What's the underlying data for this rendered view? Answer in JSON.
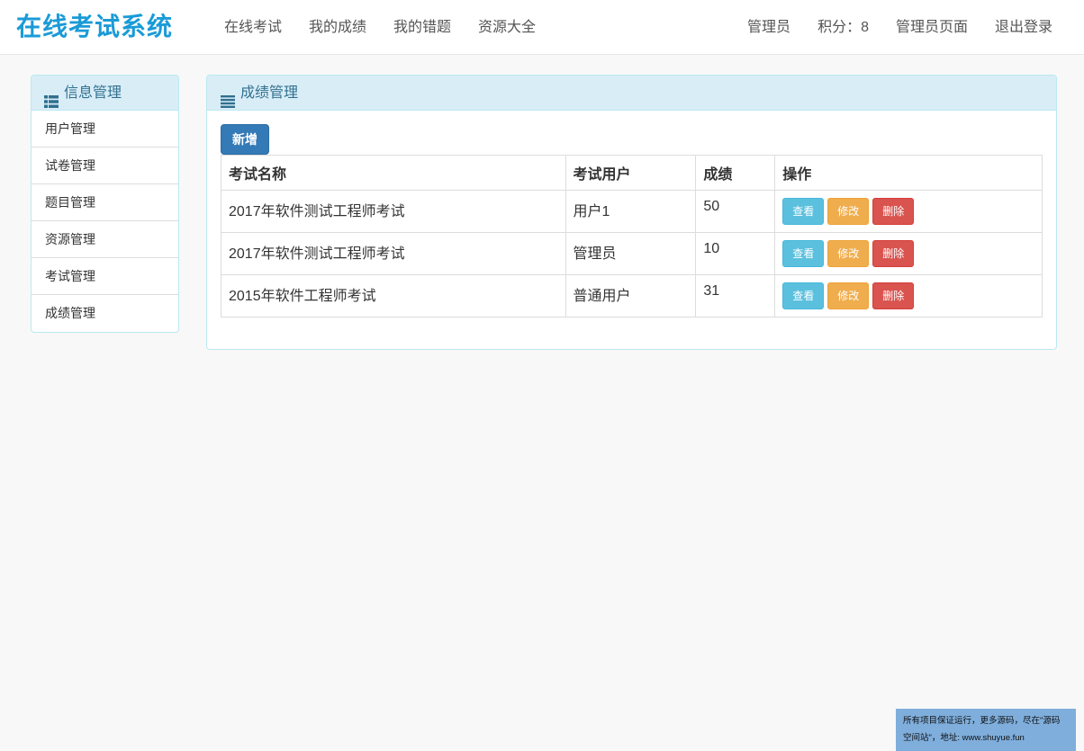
{
  "navbar": {
    "brand": "在线考试系统",
    "left_links": [
      "在线考试",
      "我的成绩",
      "我的错题",
      "资源大全"
    ],
    "user_name": "管理员",
    "points": "积分：8",
    "admin_page": "管理员页面",
    "logout": "退出登录",
    "brand_color": "#1a9bd7"
  },
  "sidebar": {
    "title": "信息管理",
    "icon": "list-icon",
    "items": [
      {
        "label": "用户管理"
      },
      {
        "label": "试卷管理"
      },
      {
        "label": "题目管理"
      },
      {
        "label": "资源管理"
      },
      {
        "label": "考试管理"
      },
      {
        "label": "成绩管理"
      }
    ]
  },
  "main": {
    "title": "成绩管理",
    "icon": "menu-icon",
    "add_label": "新增",
    "table": {
      "headers": [
        "考试名称",
        "考试用户",
        "成绩",
        "操作"
      ],
      "rows": [
        {
          "exam": "2017年软件测试工程师考试",
          "user": "用户1",
          "score": "50"
        },
        {
          "exam": "2017年软件测试工程师考试",
          "user": "管理员",
          "score": "10"
        },
        {
          "exam": "2015年软件工程师考试",
          "user": "普通用户",
          "score": "31"
        }
      ],
      "actions": {
        "view": "查看",
        "edit": "修改",
        "delete": "删除"
      }
    },
    "colors": {
      "view": "#5bc0de",
      "edit": "#f0ad4e",
      "delete": "#d9534f",
      "primary": "#337ab7"
    }
  },
  "watermark": {
    "line1": "所有项目保证运行，更多源码，尽在\"源码",
    "line2": "空间站\"，地址: www.shuyue.fun"
  }
}
